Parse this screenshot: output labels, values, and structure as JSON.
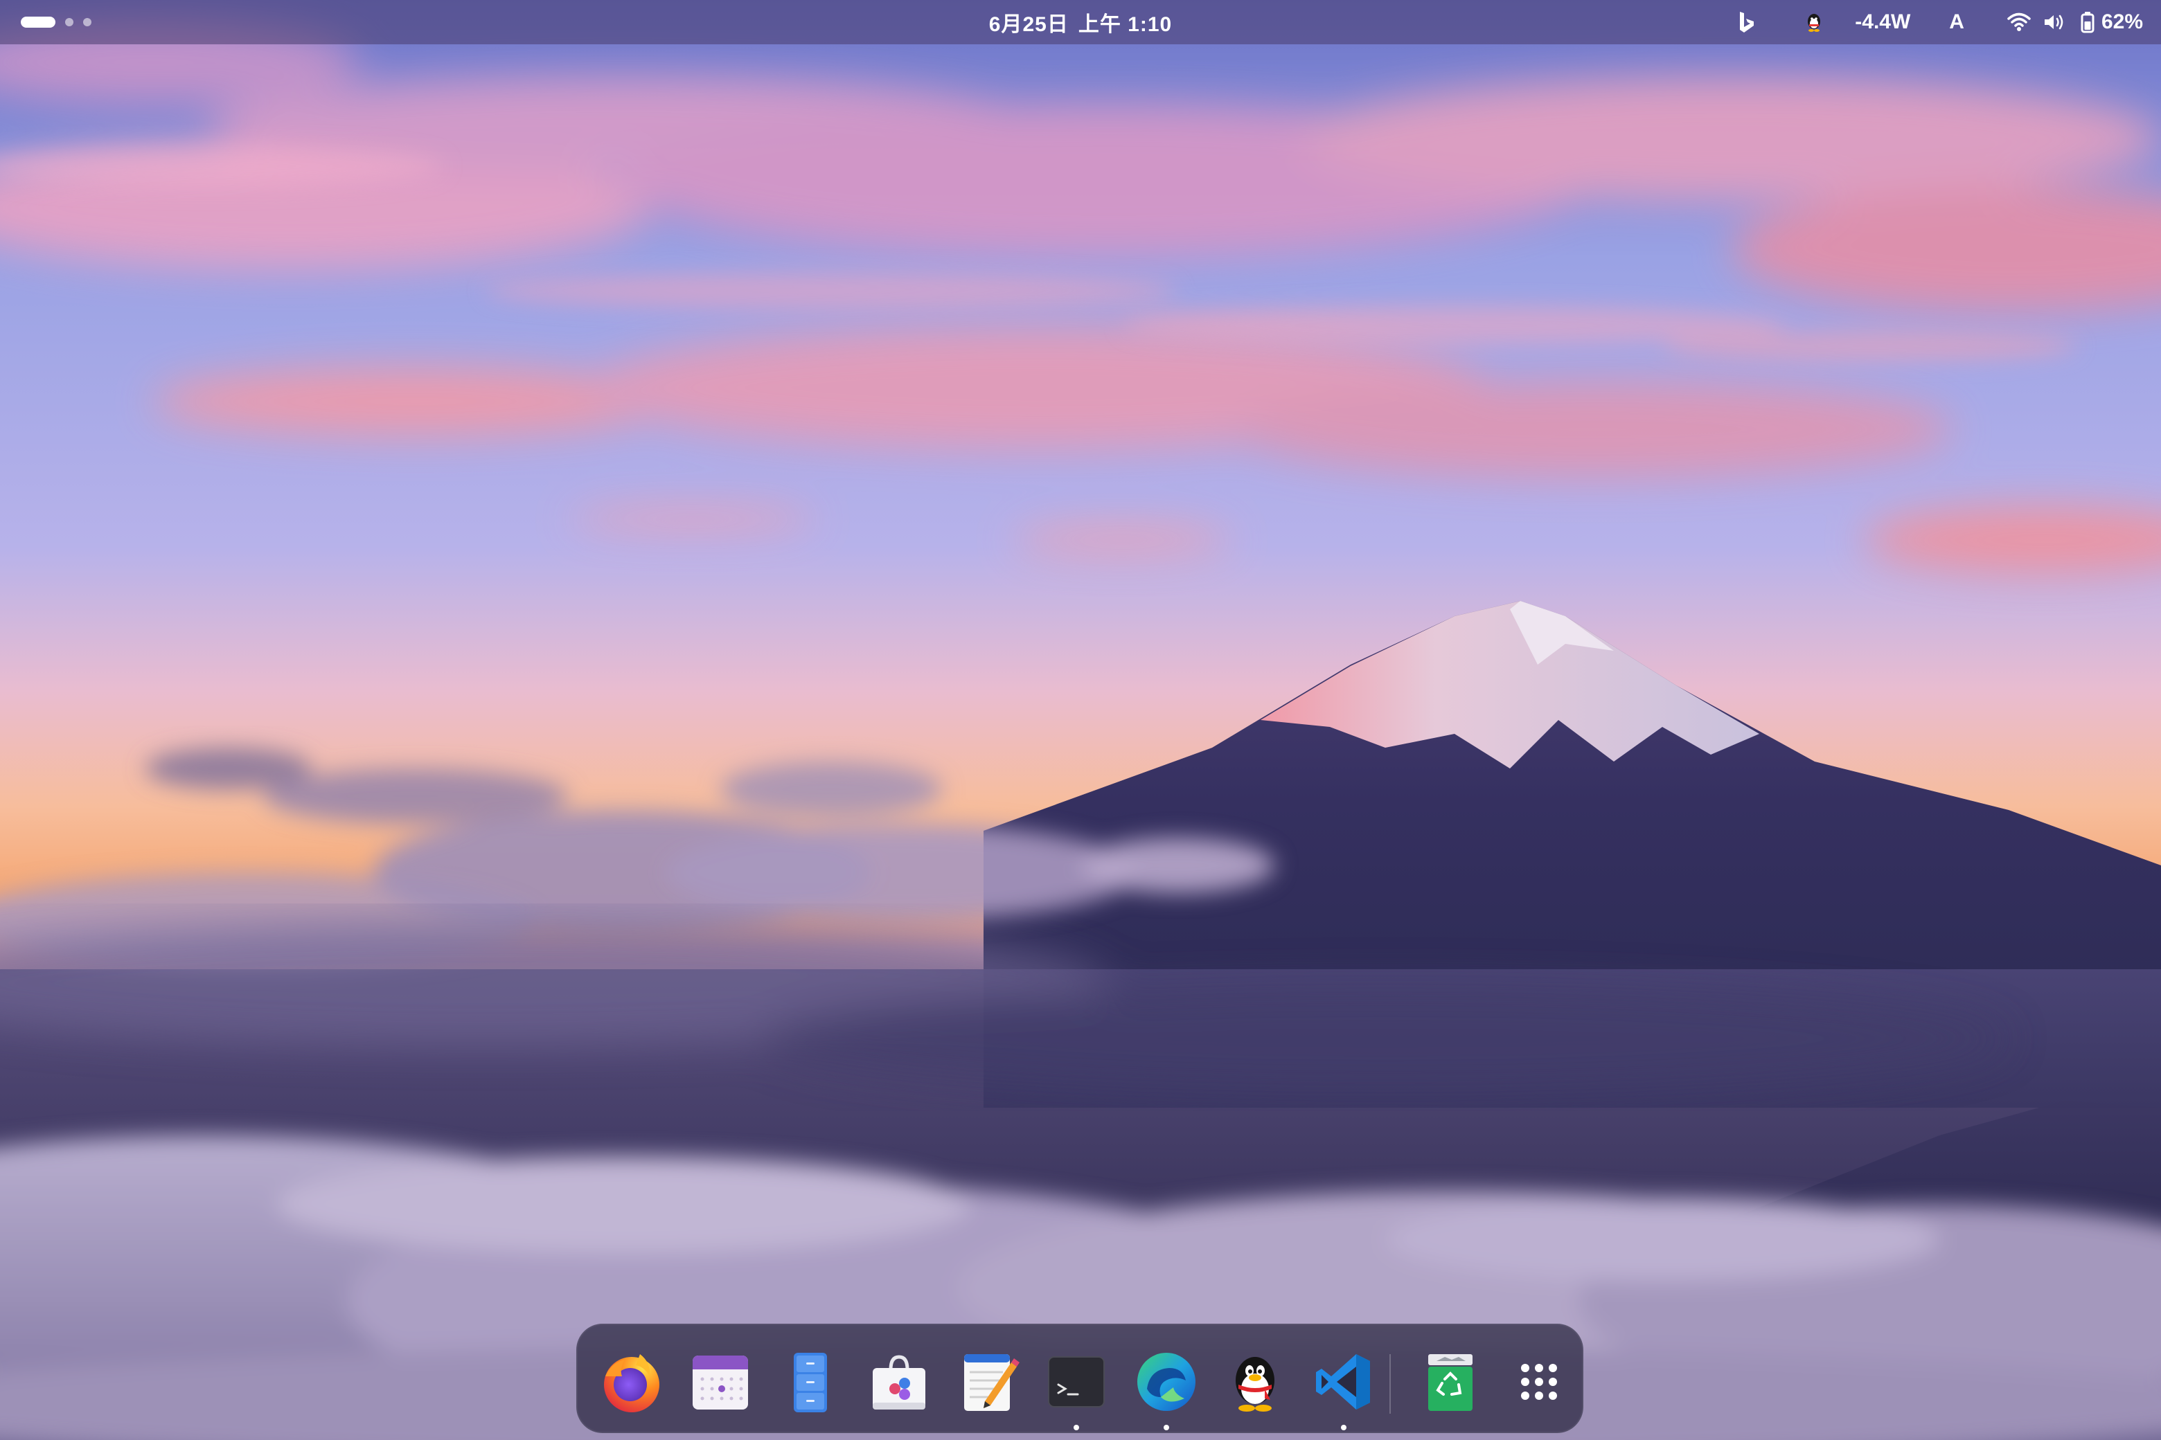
{
  "topbar": {
    "date": "6月25日",
    "time": "上午 1:10",
    "power_draw": "-4.4W",
    "input_method": "A",
    "battery": "62%",
    "tray_icons": [
      "bing-icon",
      "qq-tray-icon",
      "wifi-icon",
      "volume-icon",
      "battery-icon"
    ]
  },
  "dock": {
    "apps": [
      {
        "name": "Firefox",
        "icon": "firefox-icon",
        "running": false
      },
      {
        "name": "Calendar",
        "icon": "calendar-icon",
        "running": false
      },
      {
        "name": "Files",
        "icon": "files-cabinet-icon",
        "running": false
      },
      {
        "name": "Software",
        "icon": "app-store-icon",
        "running": false
      },
      {
        "name": "Text Editor",
        "icon": "text-editor-icon",
        "running": false
      },
      {
        "name": "Terminal",
        "icon": "terminal-icon",
        "running": true
      },
      {
        "name": "Microsoft Edge",
        "icon": "edge-icon",
        "running": true
      },
      {
        "name": "QQ",
        "icon": "qq-penguin-icon",
        "running": false
      },
      {
        "name": "Visual Studio Code",
        "icon": "vscode-icon",
        "running": true
      },
      {
        "name": "Trash",
        "icon": "trash-icon",
        "running": false
      },
      {
        "name": "Show Applications",
        "icon": "app-grid-icon",
        "running": false
      }
    ]
  },
  "colors": {
    "sky_top": "#7f7fcf",
    "sky_horizon": "#f7b080",
    "cloud_pink": "#f09ab6",
    "mountain": "#3a3462",
    "snow": "#d9d2e6",
    "fog": "#8c80ad",
    "dock_bg": "#28263e"
  }
}
